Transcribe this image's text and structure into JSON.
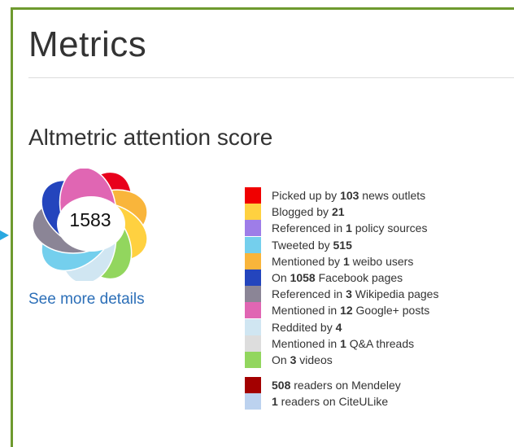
{
  "header": {
    "title": "Metrics"
  },
  "score_section": {
    "heading": "Altmetric attention score",
    "score": "1583",
    "details_link": "See more details"
  },
  "sources": [
    {
      "pre": "Picked up by ",
      "count": "103",
      "post": " news outlets",
      "color": "#f00000"
    },
    {
      "pre": "Blogged by ",
      "count": "21",
      "post": "",
      "color": "#ffd140"
    },
    {
      "pre": "Referenced in ",
      "count": "1",
      "post": " policy sources",
      "color": "#9e7de8"
    },
    {
      "pre": "Tweeted by ",
      "count": "515",
      "post": "",
      "color": "#74cfed"
    },
    {
      "pre": "Mentioned by ",
      "count": "1",
      "post": " weibo users",
      "color": "#f9b53b"
    },
    {
      "pre": "On ",
      "count": "1058",
      "post": " Facebook pages",
      "color": "#2445bd"
    },
    {
      "pre": "Referenced in ",
      "count": "3",
      "post": " Wikipedia pages",
      "color": "#8b8596"
    },
    {
      "pre": "Mentioned in ",
      "count": "12",
      "post": " Google+ posts",
      "color": "#e066b3"
    },
    {
      "pre": "Reddited by ",
      "count": "4",
      "post": "",
      "color": "#d0e6f2"
    },
    {
      "pre": "Mentioned in ",
      "count": "1",
      "post": " Q&A threads",
      "color": "#dddddd"
    },
    {
      "pre": "On ",
      "count": "3",
      "post": " videos",
      "color": "#92d65e"
    }
  ],
  "readers": [
    {
      "pre": "",
      "count": "508",
      "post": " readers on Mendeley",
      "color": "#a30000"
    },
    {
      "pre": "",
      "count": "1",
      "post": " readers on CiteULike",
      "color": "#bcd2ef"
    }
  ],
  "donut_colors": [
    "#e8001c",
    "#f9b53b",
    "#ffd140",
    "#92d65e",
    "#d0e6f2",
    "#74cfed",
    "#8b8596",
    "#2445bd",
    "#e066b3"
  ]
}
